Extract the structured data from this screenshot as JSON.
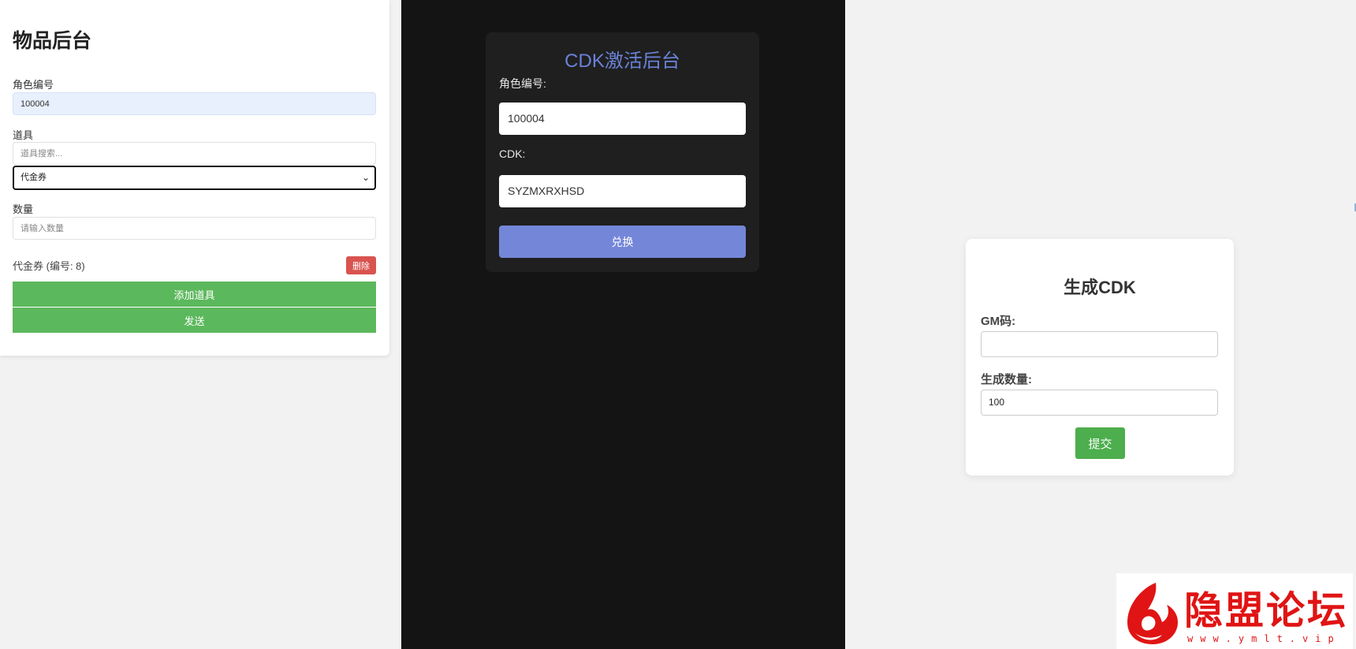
{
  "items_backend": {
    "title": "物品后台",
    "role_id_label": "角色编号",
    "role_id_value": "100004",
    "item_label": "道具",
    "item_search_placeholder": "道具搜索...",
    "item_selected": "代金券",
    "quantity_label": "数量",
    "quantity_placeholder": "请输入数量",
    "added_item": "代金券 (编号: 8)",
    "delete_label": "删除",
    "add_item_label": "添加道具",
    "send_label": "发送"
  },
  "cdk_activation": {
    "title": "CDK激活后台",
    "role_id_label": "角色编号:",
    "role_id_value": "100004",
    "cdk_label": "CDK:",
    "cdk_value": "SYZMXRXHSD",
    "redeem_label": "兑换"
  },
  "cdk_generate": {
    "title": "生成CDK",
    "gm_code_label": "GM码:",
    "gm_code_value": "",
    "count_label": "生成数量:",
    "count_value": "100",
    "submit_label": "提交"
  },
  "watermark": {
    "text": "隐盟论坛",
    "url": "www.ymlt.vip"
  },
  "colors": {
    "green": "#5cb85c",
    "danger": "#d9534f",
    "cdk_accent": "#6a82d8",
    "dark_bg": "#141414",
    "watermark_red": "#e01414"
  }
}
